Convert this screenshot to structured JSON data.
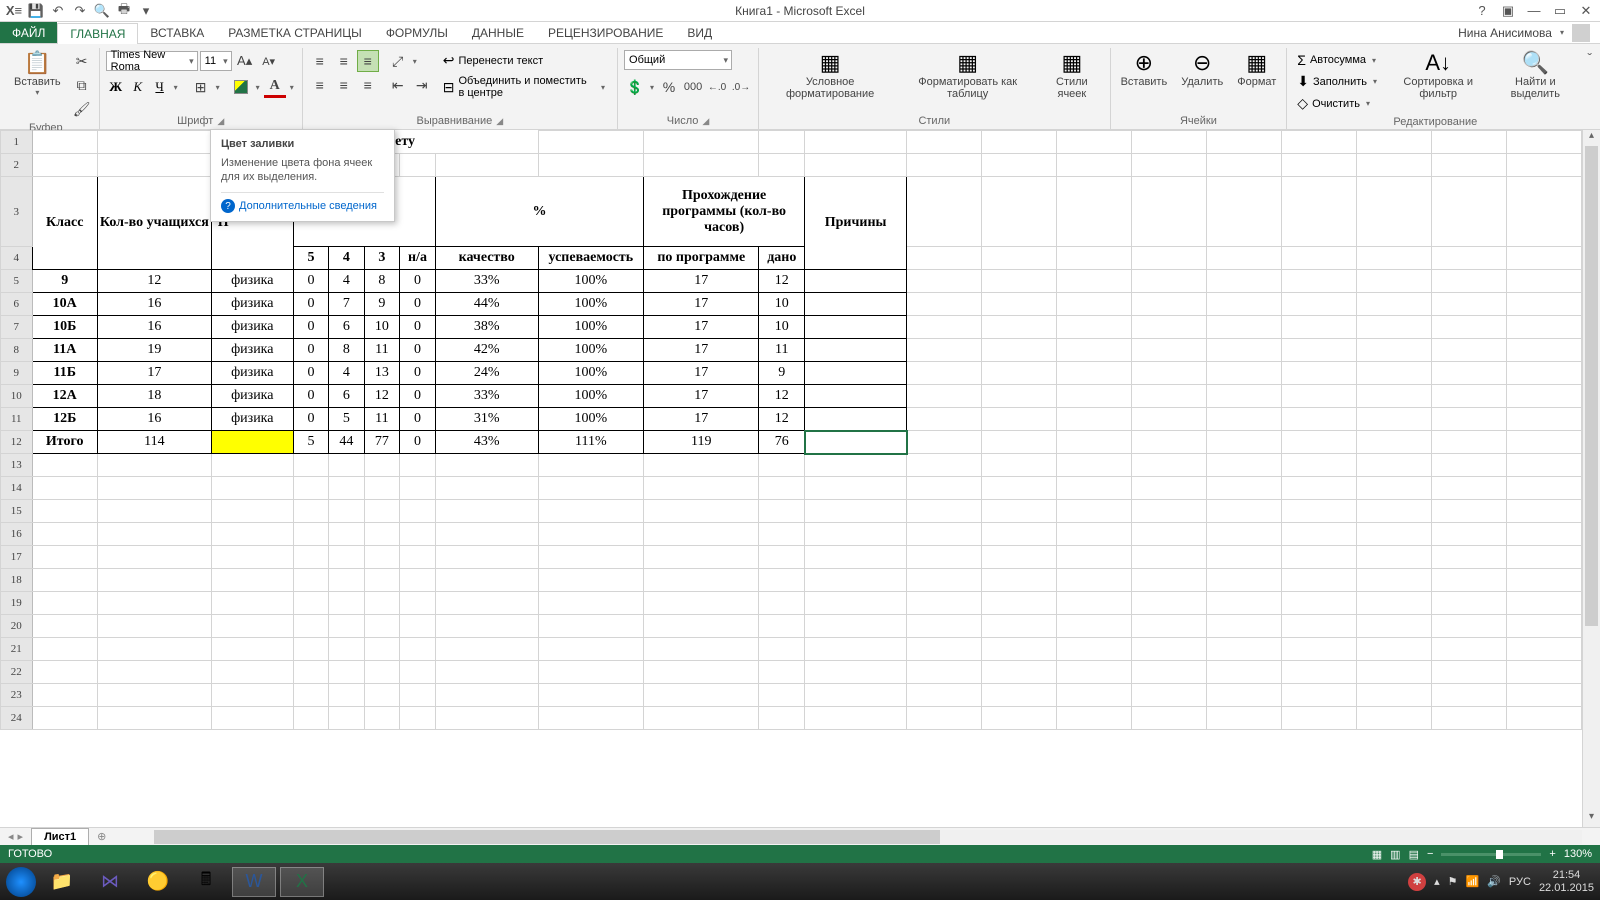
{
  "titlebar": {
    "title": "Книга1 - Microsoft Excel"
  },
  "tabs": {
    "file": "ФАЙЛ",
    "home": "ГЛАВНАЯ",
    "insert": "ВСТАВКА",
    "layout": "РАЗМЕТКА СТРАНИЦЫ",
    "formulas": "ФОРМУЛЫ",
    "data": "ДАННЫЕ",
    "review": "РЕЦЕНЗИРОВАНИЕ",
    "view": "ВИД",
    "user": "Нина Анисимова"
  },
  "ribbon": {
    "clipboard": {
      "label": "Буфер обмена",
      "paste": "Вставить"
    },
    "font": {
      "label": "Шрифт",
      "name": "Times New Roma",
      "size": "11"
    },
    "alignment": {
      "label": "Выравнивание",
      "wrap": "Перенести текст",
      "merge": "Объединить и поместить в центре"
    },
    "number": {
      "label": "Число",
      "format": "Общий"
    },
    "styles": {
      "label": "Стили",
      "cond": "Условное форматирование",
      "table": "Форматировать как таблицу",
      "cell": "Стили ячеек"
    },
    "cells": {
      "label": "Ячейки",
      "insert": "Вставить",
      "delete": "Удалить",
      "format": "Формат"
    },
    "editing": {
      "label": "Редактирование",
      "autosum": "Автосумма",
      "fill": "Заполнить",
      "clear": "Очистить",
      "sort": "Сортировка и фильтр",
      "find": "Найти и выделить"
    }
  },
  "tooltip": {
    "title": "Цвет заливки",
    "body": "Изменение цвета фона ячеек для их выделения.",
    "link": "Дополнительные сведения"
  },
  "sheet_title": "Отчет по предмету",
  "table": {
    "headers": {
      "klass": "Класс",
      "students": "Кол-во учащихся",
      "subject_prefix": "П",
      "percent": "%",
      "program": "Прохождение программы (кол-во часов)",
      "reasons": "Причины",
      "g5": "5",
      "g4": "4",
      "g3": "3",
      "na": "н/а",
      "quality": "качество",
      "success": "успеваемость",
      "byprog": "по программе",
      "given": "дано"
    },
    "rows": [
      {
        "klass": "9",
        "students": "12",
        "subject": "физика",
        "g5": "0",
        "g4": "4",
        "g3": "8",
        "na": "0",
        "quality": "33%",
        "success": "100%",
        "byprog": "17",
        "given": "12"
      },
      {
        "klass": "10А",
        "students": "16",
        "subject": "физика",
        "g5": "0",
        "g4": "7",
        "g3": "9",
        "na": "0",
        "quality": "44%",
        "success": "100%",
        "byprog": "17",
        "given": "10"
      },
      {
        "klass": "10Б",
        "students": "16",
        "subject": "физика",
        "g5": "0",
        "g4": "6",
        "g3": "10",
        "na": "0",
        "quality": "38%",
        "success": "100%",
        "byprog": "17",
        "given": "10"
      },
      {
        "klass": "11А",
        "students": "19",
        "subject": "физика",
        "g5": "0",
        "g4": "8",
        "g3": "11",
        "na": "0",
        "quality": "42%",
        "success": "100%",
        "byprog": "17",
        "given": "11"
      },
      {
        "klass": "11Б",
        "students": "17",
        "subject": "физика",
        "g5": "0",
        "g4": "4",
        "g3": "13",
        "na": "0",
        "quality": "24%",
        "success": "100%",
        "byprog": "17",
        "given": "9"
      },
      {
        "klass": "12А",
        "students": "18",
        "subject": "физика",
        "g5": "0",
        "g4": "6",
        "g3": "12",
        "na": "0",
        "quality": "33%",
        "success": "100%",
        "byprog": "17",
        "given": "12"
      },
      {
        "klass": "12Б",
        "students": "16",
        "subject": "физика",
        "g5": "0",
        "g4": "5",
        "g3": "11",
        "na": "0",
        "quality": "31%",
        "success": "100%",
        "byprog": "17",
        "given": "12"
      }
    ],
    "total": {
      "klass": "Итого",
      "students": "114",
      "subject": "",
      "g5": "5",
      "g4": "44",
      "g3": "77",
      "na": "0",
      "quality": "43%",
      "success": "111%",
      "byprog": "119",
      "given": "76"
    }
  },
  "sheet_tabs": {
    "sheet1": "Лист1"
  },
  "statusbar": {
    "ready": "ГОТОВО",
    "zoom": "130%"
  },
  "taskbar": {
    "lang": "РУС",
    "time": "21:54",
    "date": "22.01.2015"
  }
}
